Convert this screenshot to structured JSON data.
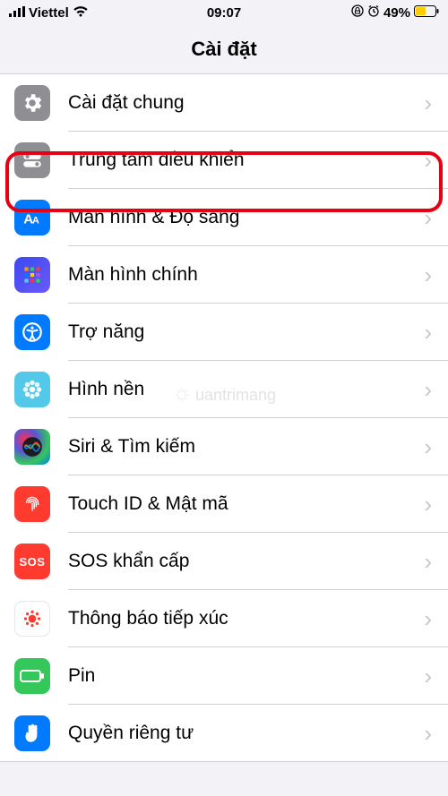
{
  "statusbar": {
    "carrier": "Viettel",
    "time": "09:07",
    "battery_pct": "49%"
  },
  "header": {
    "title": "Cài đặt"
  },
  "rows": [
    {
      "id": "general",
      "label": "Cài đặt chung"
    },
    {
      "id": "control-center",
      "label": "Trung tâm điều khiển"
    },
    {
      "id": "display",
      "label": "Màn hình & Độ sáng"
    },
    {
      "id": "home-screen",
      "label": "Màn hình chính"
    },
    {
      "id": "accessibility",
      "label": "Trợ năng"
    },
    {
      "id": "wallpaper",
      "label": "Hình nền"
    },
    {
      "id": "siri",
      "label": "Siri & Tìm kiếm"
    },
    {
      "id": "touchid",
      "label": "Touch ID & Mật mã"
    },
    {
      "id": "sos",
      "label": "SOS khẩn cấp"
    },
    {
      "id": "exposure",
      "label": "Thông báo tiếp xúc"
    },
    {
      "id": "battery",
      "label": "Pin"
    },
    {
      "id": "privacy",
      "label": "Quyền riêng tư"
    }
  ],
  "watermark": "uantrimang"
}
